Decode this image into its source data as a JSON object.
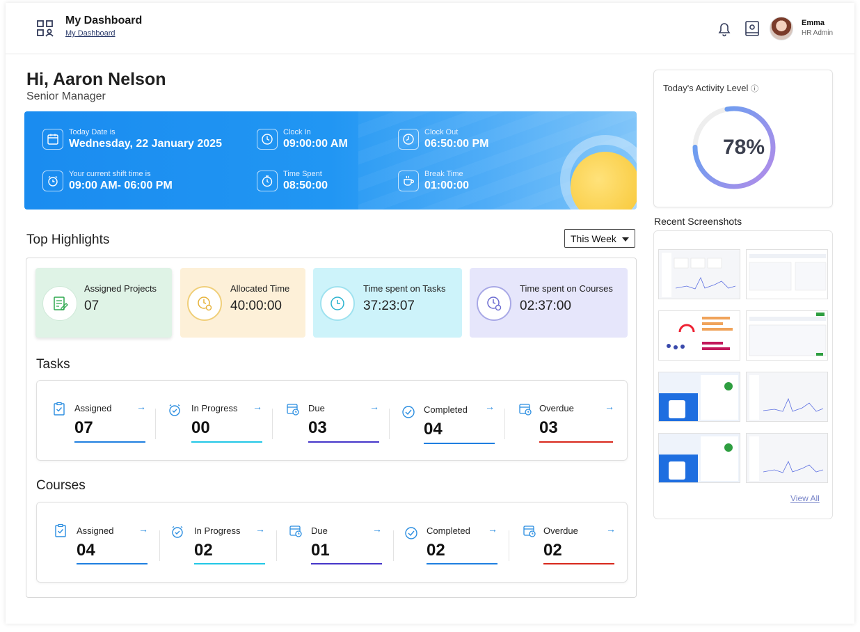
{
  "header": {
    "title": "My Dashboard",
    "breadcrumb": "My Dashboard",
    "user": {
      "name": "Emma",
      "role": "HR Admin"
    }
  },
  "greeting": {
    "hello": "Hi, Aaron Nelson",
    "role": "Senior Manager"
  },
  "banner": [
    {
      "label": "Today Date is",
      "value": "Wednesday, 22 January 2025",
      "icon": "calendar-icon"
    },
    {
      "label": "Clock In",
      "value": "09:00:00 AM",
      "icon": "clock-icon"
    },
    {
      "label": "Clock Out",
      "value": "06:50:00 PM",
      "icon": "clock-icon"
    },
    {
      "label": "Your current shift time is",
      "value": "09:00 AM- 06:00 PM",
      "icon": "alarm-icon"
    },
    {
      "label": "Time Spent",
      "value": "08:50:00",
      "icon": "stopwatch-icon"
    },
    {
      "label": "Break Time",
      "value": "01:00:00",
      "icon": "coffee-icon"
    }
  ],
  "activity": {
    "title": "Today's Activity Level",
    "value": "78%",
    "level": 0.78
  },
  "screenshots": {
    "title": "Recent Screenshots",
    "view_all": "View All"
  },
  "highlights": {
    "title": "Top Highlights",
    "period": "This Week",
    "items": [
      {
        "label": "Assigned Projects",
        "value": "07",
        "color": "#dff3e6",
        "accent": "#2fa84f"
      },
      {
        "label": "Allocated Time",
        "value": "40:00:00",
        "color": "#fdf0d8",
        "accent": "#e6b23a"
      },
      {
        "label": "Time spent on Tasks",
        "value": "37:23:07",
        "color": "#cdf3fa",
        "accent": "#2bb3cf"
      },
      {
        "label": "Time spent on Courses",
        "value": "02:37:00",
        "color": "#e6e6fb",
        "accent": "#6a6ad0"
      }
    ]
  },
  "tasks": {
    "title": "Tasks",
    "items": [
      {
        "label": "Assigned",
        "value": "07",
        "bar": "#1f7fe0"
      },
      {
        "label": "In Progress",
        "value": "00",
        "bar": "#22c7e6"
      },
      {
        "label": "Due",
        "value": "03",
        "bar": "#4536c9"
      },
      {
        "label": "Completed",
        "value": "04",
        "bar": "#1f7fe0"
      },
      {
        "label": "Overdue",
        "value": "03",
        "bar": "#d8281c"
      }
    ]
  },
  "courses": {
    "title": "Courses",
    "items": [
      {
        "label": "Assigned",
        "value": "04",
        "bar": "#1f7fe0"
      },
      {
        "label": "In Progress",
        "value": "02",
        "bar": "#22c7e6"
      },
      {
        "label": "Due",
        "value": "01",
        "bar": "#4536c9"
      },
      {
        "label": "Completed",
        "value": "02",
        "bar": "#1f7fe0"
      },
      {
        "label": "Overdue",
        "value": "02",
        "bar": "#d8281c"
      }
    ]
  }
}
